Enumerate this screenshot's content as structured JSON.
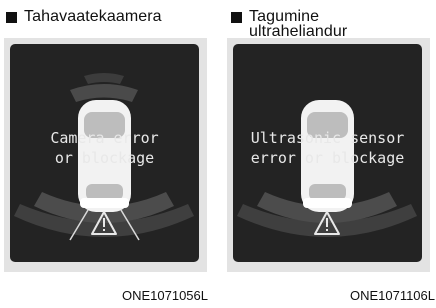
{
  "left_panel": {
    "heading": "Tahavaatekaamera",
    "message_line1": "Camera error",
    "message_line2": "or blockage",
    "code": "ONE1071056L"
  },
  "right_panel": {
    "heading_line1": "Tagumine",
    "heading_line2": "ultraheliandur",
    "message_line1": "Ultrasonic sensor",
    "message_line2": "error or blockage",
    "code": "ONE1071106L"
  },
  "colors": {
    "screen_background": "#232323",
    "frame_background": "#e3e3e3",
    "sensor_zones": "#4a4a4a",
    "car_body": "#ffffff"
  },
  "icons": [
    "warning-triangle-icon",
    "car-top-view-icon"
  ]
}
